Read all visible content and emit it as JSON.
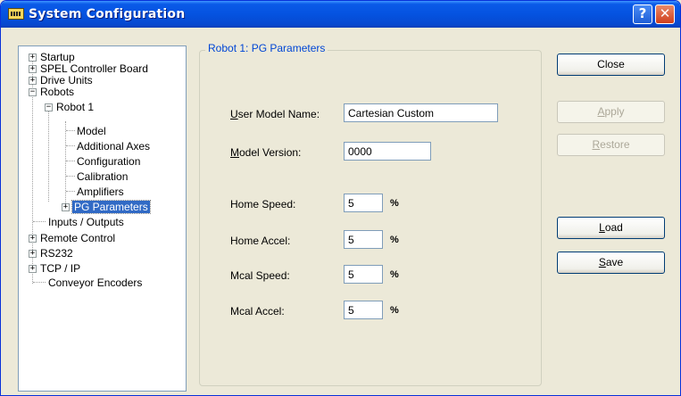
{
  "window": {
    "title": "System Configuration",
    "help_glyph": "?",
    "close_glyph": "✕"
  },
  "tree": {
    "items": [
      {
        "label": "Startup",
        "expander": "+"
      },
      {
        "label": "SPEL Controller Board",
        "expander": "+"
      },
      {
        "label": "Drive Units",
        "expander": "+"
      },
      {
        "label": "Robots",
        "expander": "−"
      },
      {
        "label": "Robot 1",
        "expander": "−"
      },
      {
        "label": "Model"
      },
      {
        "label": "Additional Axes"
      },
      {
        "label": "Configuration"
      },
      {
        "label": "Calibration"
      },
      {
        "label": "Amplifiers"
      },
      {
        "label": "PG Parameters",
        "expander": "+",
        "selected": true
      },
      {
        "label": "Inputs / Outputs"
      },
      {
        "label": "Remote Control",
        "expander": "+"
      },
      {
        "label": "RS232",
        "expander": "+"
      },
      {
        "label": "TCP / IP",
        "expander": "+"
      },
      {
        "label": "Conveyor Encoders"
      }
    ]
  },
  "group": {
    "title": "Robot 1: PG Parameters"
  },
  "form": {
    "user_model_name": {
      "mnemonic": "U",
      "label_rest": "ser Model Name:",
      "value": "Cartesian Custom"
    },
    "model_version": {
      "mnemonic": "M",
      "label_rest": "odel Version:",
      "value": "0000"
    },
    "home_speed": {
      "label": "Home Speed:",
      "value": "5",
      "unit": "%"
    },
    "home_accel": {
      "label": "Home Accel:",
      "value": "5",
      "unit": "%"
    },
    "mcal_speed": {
      "label": "Mcal Speed:",
      "value": "5",
      "unit": "%"
    },
    "mcal_accel": {
      "label": "Mcal Accel:",
      "value": "5",
      "unit": "%"
    }
  },
  "buttons": {
    "close": {
      "label": "Close",
      "enabled": true
    },
    "apply": {
      "mnemonic": "A",
      "rest": "pply",
      "enabled": false
    },
    "restore": {
      "mnemonic": "R",
      "rest": "estore",
      "enabled": false
    },
    "load": {
      "mnemonic": "L",
      "rest": "oad",
      "enabled": true
    },
    "save": {
      "mnemonic": "S",
      "rest": "ave",
      "enabled": true
    }
  },
  "colors": {
    "title_bar": "#0553e0",
    "selection": "#316ac5",
    "group_title": "#0046d5",
    "face": "#ece9d8"
  }
}
